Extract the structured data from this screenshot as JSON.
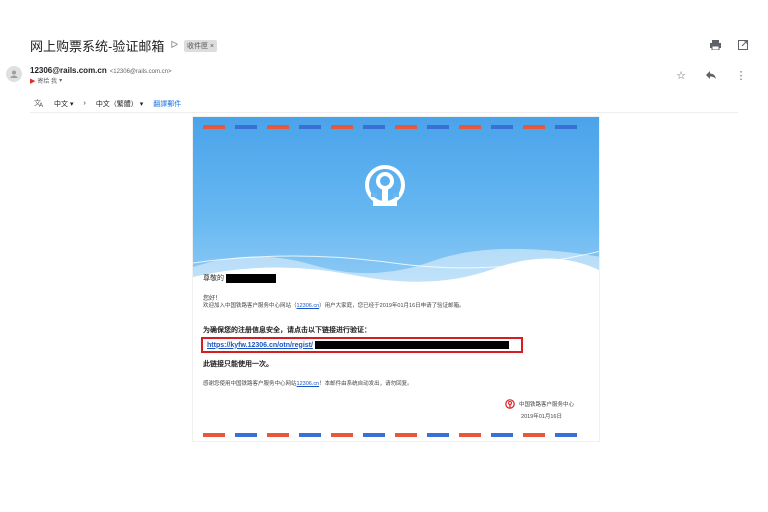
{
  "email": {
    "subject": "网上购票系统-验证邮箱",
    "label_chip": "收件匣 ×",
    "sender_name": "12306@rails.com.cn",
    "sender_address": "<12306@rails.com.cn>",
    "recipient": "寄给 我"
  },
  "translate": {
    "source_lang": "中文",
    "target_lang": "中文（繁體）",
    "action": "翻譯郵件"
  },
  "content": {
    "greeting": "尊敬的",
    "hello": "您好！",
    "welcome_before": "欢迎加入中国铁路客户服务中心网站（",
    "welcome_link": "12306.cn",
    "welcome_after": "）用户大家庭，您已经于2019年01月16日申请了验证邮箱。",
    "instruction": "为确保您的注册信息安全，请点击以下链接进行验证：",
    "verify_link": "https://kyfw.12306.cn/otn/regist/",
    "once_notice": "此链接只能使用一次。",
    "thanks_before": "感谢您使用中国铁路客户服务中心网站",
    "thanks_link": "12306.cn",
    "thanks_after": "！本邮件由系统自动发出，请勿回复。",
    "org": "中国铁路客户服务中心",
    "date": "2019年01月16日"
  },
  "icons": {
    "print": "print-icon",
    "open_new": "open-in-new-icon",
    "star": "star-icon",
    "reply": "reply-icon",
    "more": "more-vert-icon",
    "translate": "translate-icon"
  },
  "colors": {
    "hero_blue": "#4aa3ea",
    "airmail_red": "#e8563b",
    "airmail_blue": "#3b6fd6",
    "highlight_red": "#d71d24",
    "link_blue": "#1a56c2"
  }
}
